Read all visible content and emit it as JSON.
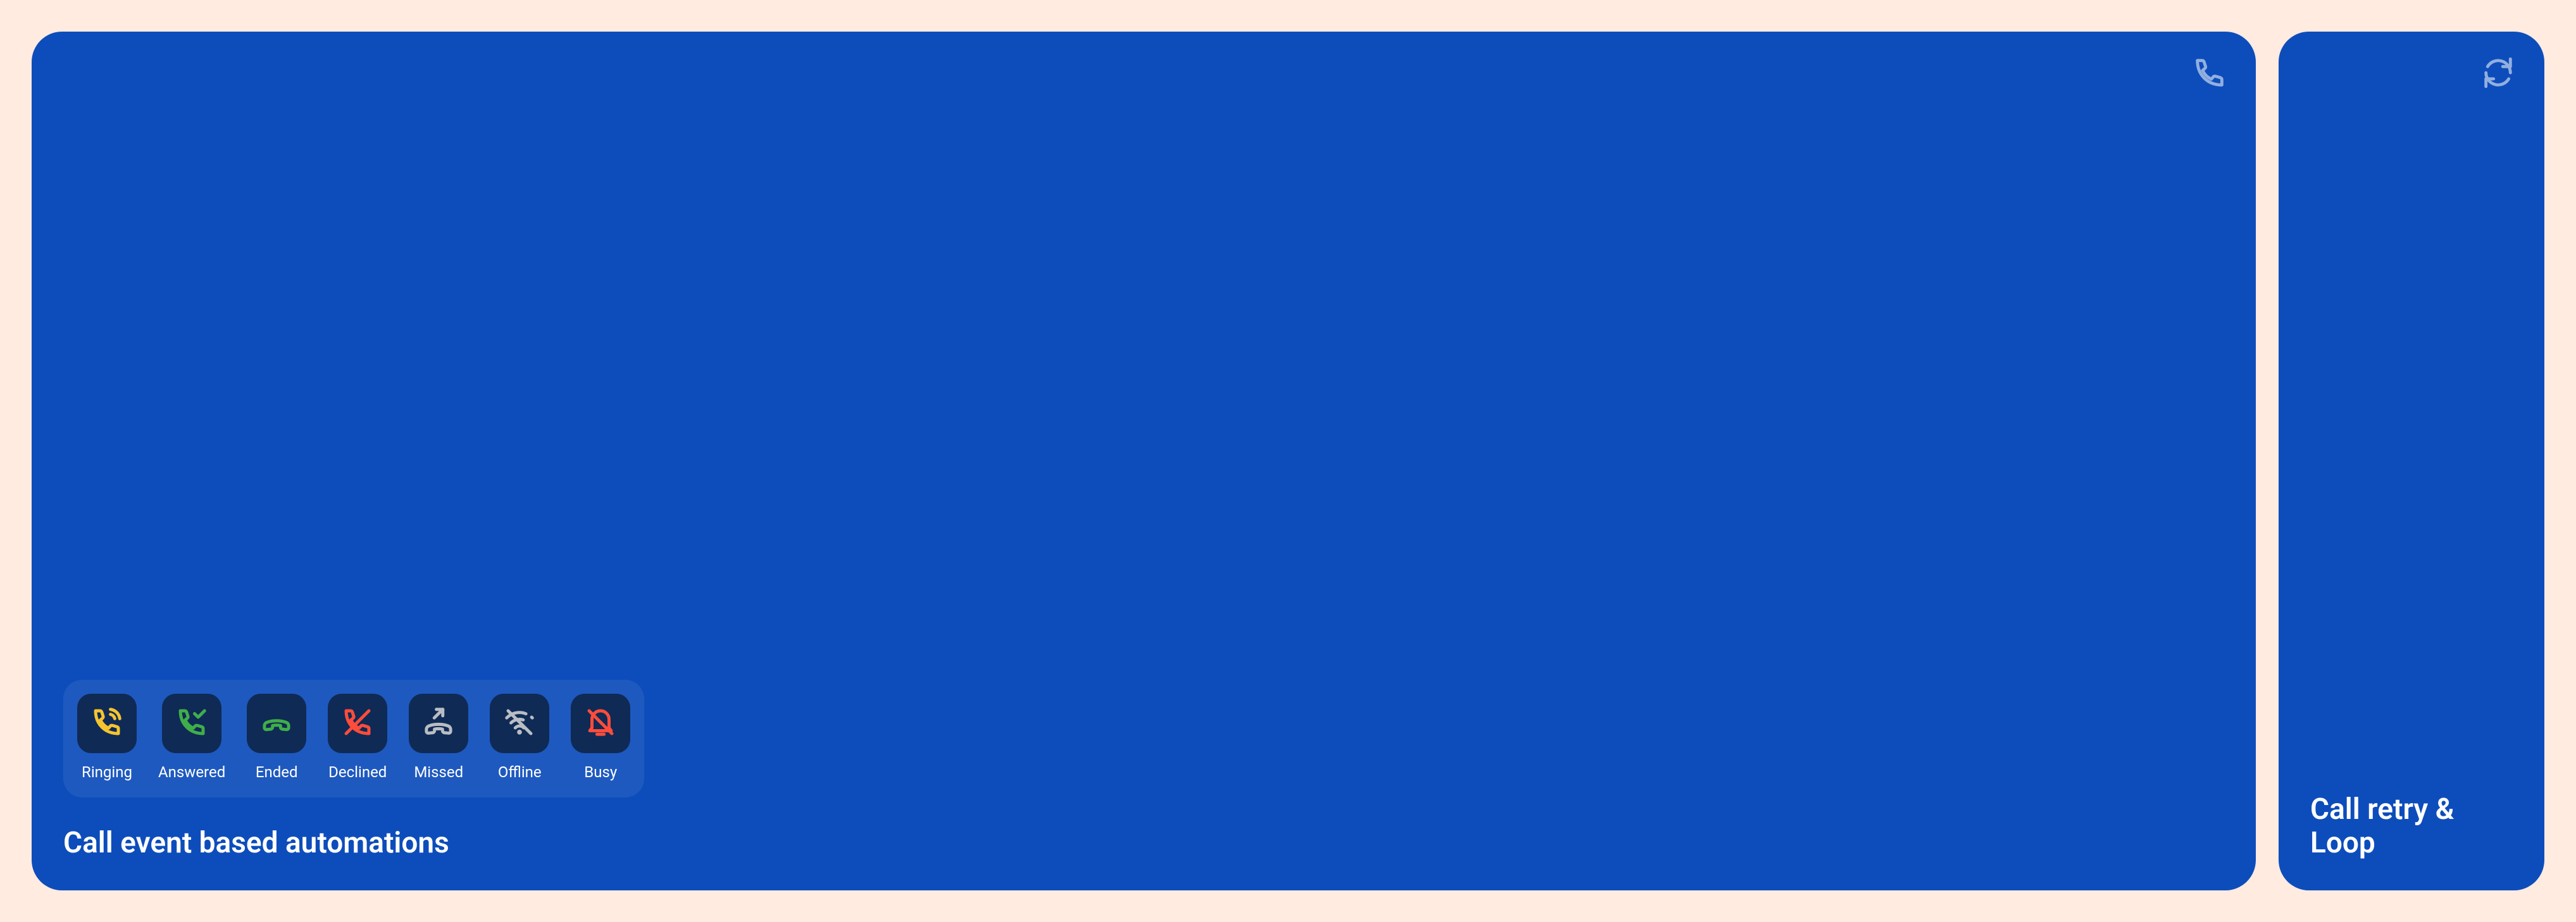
{
  "cards": {
    "events": {
      "title": "Call event based automations",
      "statuses": [
        {
          "id": "ringing",
          "label": "Ringing"
        },
        {
          "id": "answered",
          "label": "Answered"
        },
        {
          "id": "ended",
          "label": "Ended"
        },
        {
          "id": "declined",
          "label": "Declined"
        },
        {
          "id": "missed",
          "label": "Missed"
        },
        {
          "id": "offline",
          "label": "Offline"
        },
        {
          "id": "busy",
          "label": "Busy"
        }
      ]
    },
    "retry": {
      "title": "Call retry & Loop"
    }
  }
}
